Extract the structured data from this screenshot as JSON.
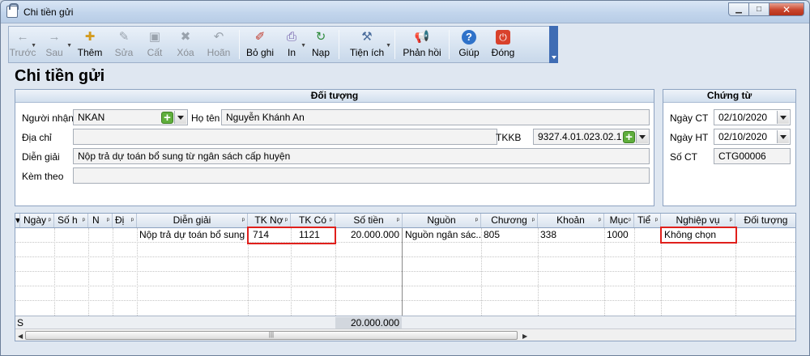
{
  "window": {
    "title": "Chi tiền gửi",
    "minimize_glyph": "▁",
    "maximize_glyph": "□",
    "close_glyph": "✕"
  },
  "toolbar": {
    "items": [
      {
        "label": "Trước",
        "icon": "←",
        "disabled": true
      },
      {
        "label": "Sau",
        "icon": "→",
        "disabled": true
      },
      {
        "label": "Thêm",
        "icon": "✚",
        "disabled": false
      },
      {
        "label": "Sửa",
        "icon": "✎",
        "disabled": true
      },
      {
        "label": "Cất",
        "icon": "▣",
        "disabled": true
      },
      {
        "label": "Xóa",
        "icon": "✖",
        "disabled": true
      },
      {
        "label": "Hoãn",
        "icon": "↶",
        "disabled": true
      },
      {
        "label": "Bỏ ghi",
        "icon": "✐",
        "disabled": false
      },
      {
        "label": "In",
        "icon": "⎙",
        "disabled": false
      },
      {
        "label": "Nạp",
        "icon": "↻",
        "disabled": false
      },
      {
        "label": "Tiện ích",
        "icon": "⚒",
        "disabled": false
      },
      {
        "label": "Phản hồi",
        "icon": "📢",
        "disabled": false
      },
      {
        "label": "Giúp",
        "icon": "?",
        "disabled": false
      },
      {
        "label": "Đóng",
        "icon": "⏻",
        "disabled": false
      }
    ]
  },
  "page_title": "Chi tiền gửi",
  "doi_tuong": {
    "header": "Đối tượng",
    "nguoi_nhan_label": "Người nhận",
    "nguoi_nhan_value": "NKAN",
    "ho_ten_label": "Họ tên",
    "ho_ten_value": "Nguyễn Khánh An",
    "dia_chi_label": "Địa chỉ",
    "dia_chi_value": "",
    "tkkb_label": "TKKB",
    "tkkb_value": "9327.4.01.023.02.1",
    "dien_giai_label": "Diễn giải",
    "dien_giai_value": "Nộp trả dự toán bổ sung từ ngân sách cấp huyện",
    "kem_theo_label": "Kèm theo",
    "kem_theo_value": ""
  },
  "chung_tu": {
    "header": "Chứng từ",
    "ngay_ct_label": "Ngày CT",
    "ngay_ct_value": "02/10/2020",
    "ngay_ht_label": "Ngày HT",
    "ngay_ht_value": "02/10/2020",
    "so_ct_label": "Số CT",
    "so_ct_value": "CTG00006"
  },
  "grid": {
    "columns": [
      "Ngày",
      "Số h",
      "N",
      "Đị",
      "Diễn giải",
      "TK Nợ",
      "TK Có",
      "Số tiền",
      "Nguồn",
      "Chương",
      "Khoản",
      "Mục",
      "Tiể",
      "Nghiệp vụ",
      "Đối tượng"
    ],
    "rows": [
      {
        "dien_giai": "Nộp trả dự toán bổ sung t...",
        "tk_no": "714",
        "tk_co": "1121",
        "so_tien": "20.000.000",
        "nguon": "Nguồn ngân sác...",
        "chuong": "805",
        "khoan": "338",
        "muc": "1000",
        "nghiep_vu": "Không chọn"
      }
    ],
    "footer_label": "S",
    "footer_total": "20.000.000"
  }
}
